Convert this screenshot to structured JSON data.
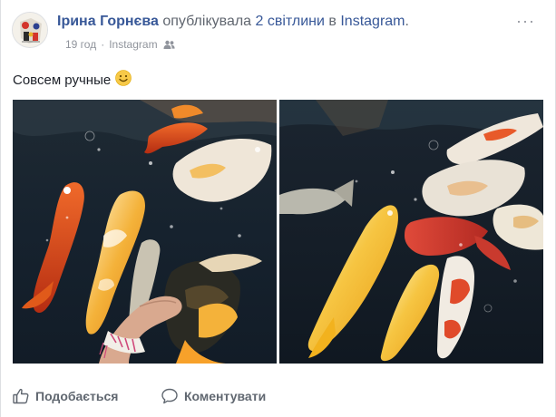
{
  "post": {
    "author": "Ірина Горнєва",
    "action_pre": "опублікувала",
    "photo_count_text": "2 світлини",
    "action_mid": "в",
    "platform": "Instagram",
    "platform_suffix": ".",
    "time": "19 год",
    "separator": "·",
    "source": "Instagram",
    "caption": "Совсем ручные",
    "menu": "···"
  },
  "actions": {
    "like": "Подобається",
    "comment": "Коментувати"
  },
  "icons": {
    "audience": "friends-icon",
    "emoji": "smile-emoji-icon",
    "like": "thumbs-up-icon",
    "comment": "comment-bubble-icon"
  },
  "colors": {
    "link": "#385898",
    "meta": "#90949c",
    "text": "#1d2129"
  }
}
